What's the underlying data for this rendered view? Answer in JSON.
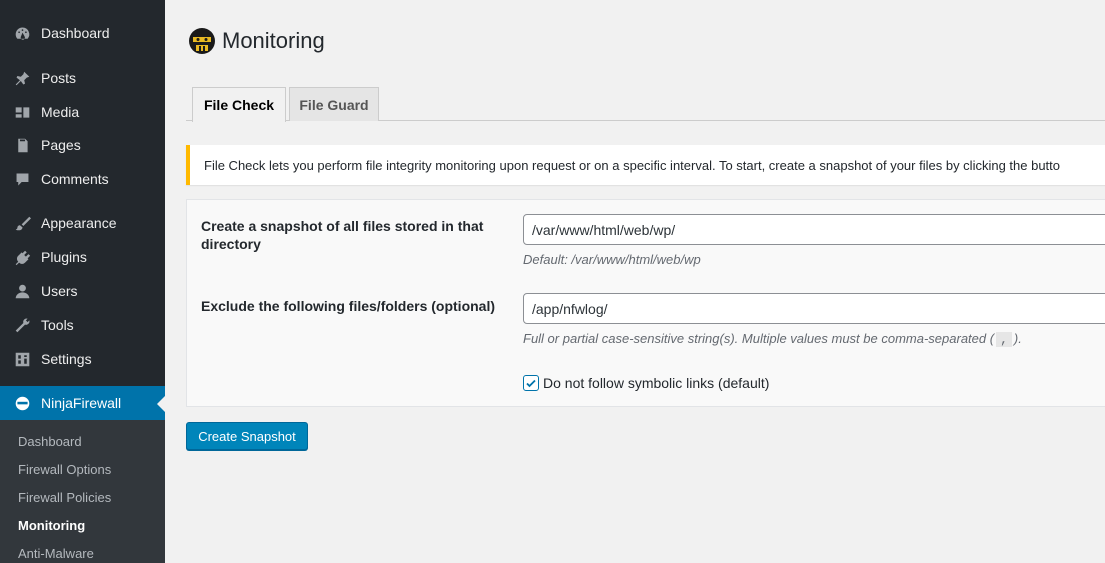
{
  "sidebar": {
    "items": [
      {
        "label": "Dashboard",
        "icon": "dashboard-icon"
      },
      {
        "label": "Posts",
        "icon": "pin-icon"
      },
      {
        "label": "Media",
        "icon": "media-icon"
      },
      {
        "label": "Pages",
        "icon": "page-icon"
      },
      {
        "label": "Comments",
        "icon": "comment-icon"
      },
      {
        "label": "Appearance",
        "icon": "paintbrush-icon"
      },
      {
        "label": "Plugins",
        "icon": "plug-icon"
      },
      {
        "label": "Users",
        "icon": "user-icon"
      },
      {
        "label": "Tools",
        "icon": "wrench-icon"
      },
      {
        "label": "Settings",
        "icon": "settings-icon"
      },
      {
        "label": "NinjaFirewall",
        "icon": "ninja-icon",
        "active": true
      }
    ],
    "submenu": [
      {
        "label": "Dashboard"
      },
      {
        "label": "Firewall Options"
      },
      {
        "label": "Firewall Policies"
      },
      {
        "label": "Monitoring",
        "current": true
      },
      {
        "label": "Anti-Malware"
      }
    ]
  },
  "page": {
    "title": "Monitoring",
    "logo_icon": "ninja-logo-icon"
  },
  "tabs": [
    {
      "label": "File Check",
      "active": true
    },
    {
      "label": "File Guard",
      "active": false
    }
  ],
  "notice": {
    "text": "File Check lets you perform file integrity monitoring upon request or on a specific interval. To start, create a snapshot of your files by clicking the butto",
    "border_color": "#ffb900"
  },
  "form": {
    "snapshot_dir": {
      "label": "Create a snapshot of all files stored in that directory",
      "value": "/var/www/html/web/wp/",
      "help": "Default: /var/www/html/web/wp"
    },
    "exclude": {
      "label": "Exclude the following files/folders (optional)",
      "value": "/app/nfwlog/",
      "help_before": "Full or partial case-sensitive string(s). Multiple values must be comma-separated (",
      "help_code": ",",
      "help_after": ")."
    },
    "symlinks": {
      "label": "Do not follow symbolic links (default)",
      "checked": true
    }
  },
  "actions": {
    "create_snapshot_label": "Create Snapshot"
  },
  "colors": {
    "sidebar_bg": "#23282d",
    "active_menu": "#0073aa",
    "primary_button": "#0085ba",
    "notice_warning": "#ffb900"
  }
}
